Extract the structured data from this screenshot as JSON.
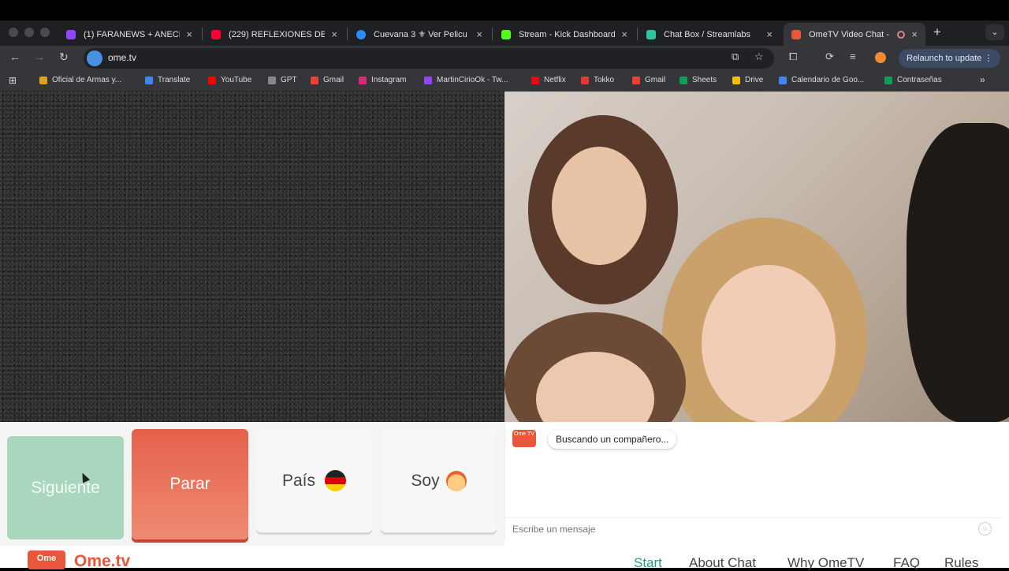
{
  "browser": {
    "tabs": [
      {
        "title": "(1) FARANEWS + ANECD",
        "favicon_color": "#9146ff"
      },
      {
        "title": "(229) REFLEXIONES DE",
        "favicon_color": "#ff0033"
      },
      {
        "title": "Cuevana 3 ⚜ Ver Pelicu",
        "favicon_color": "#2a8cff"
      },
      {
        "title": "Stream - Kick Dashboard",
        "favicon_color": "#53fc18"
      },
      {
        "title": "Chat Box / Streamlabs",
        "favicon_color": "#31c3a2"
      },
      {
        "title": "OmeTV Video Chat -",
        "favicon_color": "#e8563c",
        "active": true
      }
    ],
    "close_glyph": "×",
    "new_tab_glyph": "+",
    "url": "ome.tv",
    "relaunch_label": "Relaunch to update",
    "bookmarks": [
      {
        "label": "Oficial de Armas y...",
        "color": "#e0a020"
      },
      {
        "label": "Translate",
        "color": "#4285f4"
      },
      {
        "label": "YouTube",
        "color": "#ff0000"
      },
      {
        "label": "GPT",
        "color": "#888888"
      },
      {
        "label": "Gmail",
        "color": "#ea4335"
      },
      {
        "label": "Instagram",
        "color": "#d62976"
      },
      {
        "label": "MartinCirioOk - Tw...",
        "color": "#9146ff"
      },
      {
        "label": "Netflix",
        "color": "#e50914"
      },
      {
        "label": "Tokko",
        "color": "#e53935"
      },
      {
        "label": "Gmail",
        "color": "#ea4335"
      },
      {
        "label": "Sheets",
        "color": "#0f9d58"
      },
      {
        "label": "Drive",
        "color": "#fbbc04"
      },
      {
        "label": "Calendario de Goo...",
        "color": "#4285f4"
      },
      {
        "label": "Contraseñas",
        "color": "#0f9d58"
      }
    ]
  },
  "controls": {
    "next_label": "Siguiente",
    "stop_label": "Parar",
    "country_label": "País",
    "soy_label": "Soy"
  },
  "chat": {
    "logo_text": "Ome TV",
    "status_message": "Buscando un compañero...",
    "input_placeholder": "Escribe un mensaje"
  },
  "footer": {
    "logo_box": "Ome",
    "brand": "Ome.tv",
    "links": [
      {
        "label": "Start",
        "active": true
      },
      {
        "label": "About Chat"
      },
      {
        "label": "Why OmeTV"
      },
      {
        "label": "FAQ"
      },
      {
        "label": "Rules"
      }
    ]
  },
  "colors": {
    "accent": "#e8563c",
    "next_button": "#a9d6bd",
    "stop_button": "#e4614b",
    "active_link": "#2f9a7a"
  }
}
